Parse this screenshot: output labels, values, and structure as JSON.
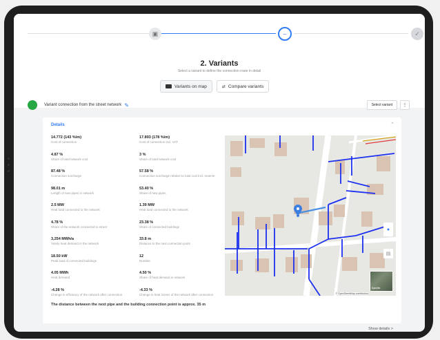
{
  "stepper": {
    "steps": [
      {
        "icon": "building-icon",
        "state": "done"
      },
      {
        "icon": "minus-icon",
        "state": "active"
      },
      {
        "icon": "check-icon",
        "state": "pending"
      }
    ]
  },
  "heading": {
    "title": "2. Variants",
    "subtitle": "Select a variant to define the connection route in detail"
  },
  "view_toggle": {
    "map_label": "Variants on map",
    "compare_label": "Compare variants"
  },
  "variant": {
    "name": "Variant connection from the street network",
    "select_label": "Select variant",
    "more_label": "⋮",
    "status_color": "#27a845"
  },
  "card": {
    "title": "Details",
    "attributes": [
      {
        "k": "14.772 (143 %/m)",
        "v": "Cost of connection"
      },
      {
        "k": "17.893 (178 %/m)",
        "v": "Cost of connection incl. VAT"
      },
      {
        "k": "4.87 %",
        "v": "Share of total network cost"
      },
      {
        "k": "3 %",
        "v": "Share of total network cost"
      },
      {
        "k": "87.48 %",
        "v": "Connection surcharge"
      },
      {
        "k": "57.58 %",
        "v": "Connection surcharge relative to total cost incl. reserve"
      },
      {
        "k": "98.01 m",
        "v": "Length of new pipes in network"
      },
      {
        "k": "53.40 %",
        "v": "Share of new pipes"
      },
      {
        "k": "2.5 MW",
        "v": "Heat load connected to the network"
      },
      {
        "k": "1.39 MW",
        "v": "Heat load connected to the network"
      },
      {
        "k": "4.78 %",
        "v": "Share of the network connected to street"
      },
      {
        "k": "23.38 %",
        "v": "Share of connected buildings"
      },
      {
        "k": "3,254 MWh/a",
        "v": "Yearly heat demand in the network"
      },
      {
        "k": "33.8 m",
        "v": "Distance to the next connection point"
      },
      {
        "k": "18.50 kW",
        "v": "Peak load of connected buildings"
      },
      {
        "k": "12",
        "v": "Number"
      },
      {
        "k": "4.05 MWh",
        "v": "Heat demand"
      },
      {
        "k": "4.50 %",
        "v": "Share of heat demand in network"
      },
      {
        "k": "-4.28 %",
        "v": "Change in efficiency of the network after connection"
      },
      {
        "k": "-4.33 %",
        "v": "Change in heat losses of the network after connection"
      }
    ],
    "summary": "The distance between the next pipe and the building connection point is approx. 35 m",
    "show_details": "Show details  >"
  },
  "map": {
    "attribution": "© OpenStreetMap contributors",
    "thumb_label": "Satellite",
    "pipe_color": "#1a2ff0",
    "connection_color": "#4a90e2",
    "marker_color": "#3d7fe0",
    "building_color": "#d9c4b3"
  }
}
